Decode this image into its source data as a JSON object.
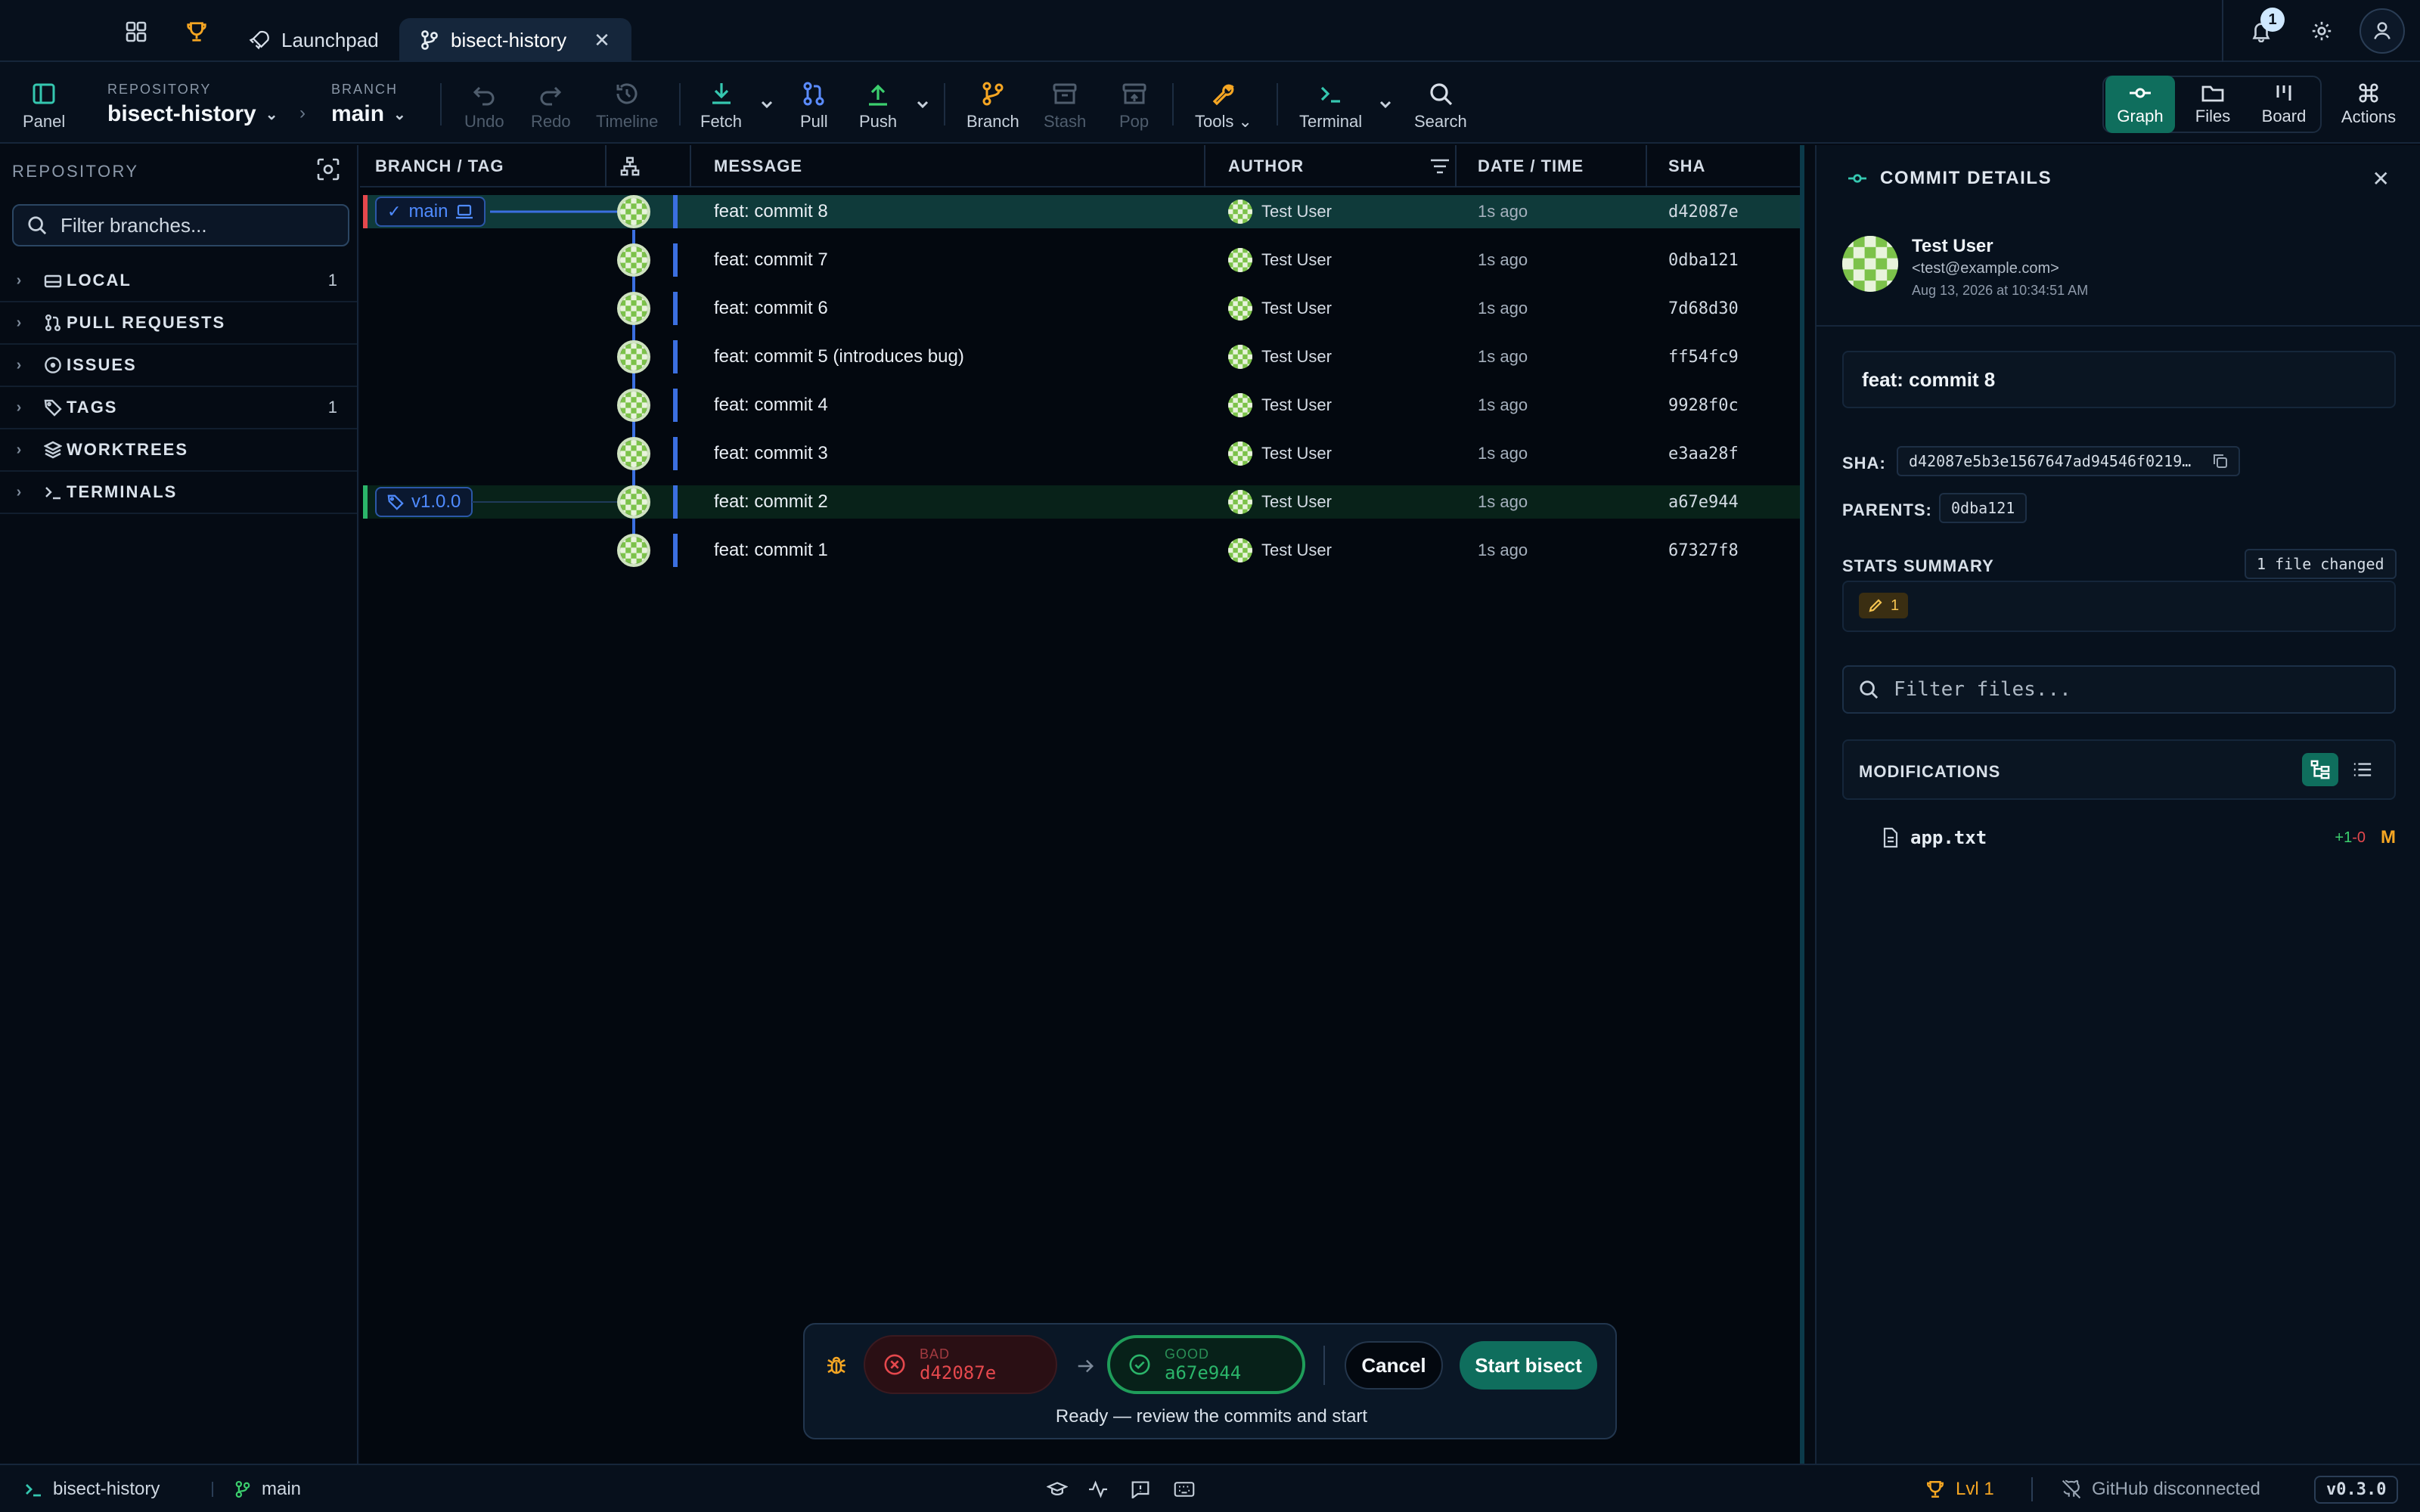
{
  "colors": {
    "accent": "#0f6e5d",
    "lane": "#3b6fe0",
    "bad": "#e5484d",
    "good": "#2bb56a",
    "warn": "#f5a623",
    "avatar": "#7cc24a"
  },
  "tabs": {
    "launchpad": "Launchpad",
    "active": "bisect-history",
    "notifications": "1"
  },
  "toolbar": {
    "panel": "Panel",
    "repo_label": "REPOSITORY",
    "repo_value": "bisect-history",
    "branch_label": "BRANCH",
    "branch_value": "main",
    "undo": "Undo",
    "redo": "Redo",
    "timeline": "Timeline",
    "fetch": "Fetch",
    "pull": "Pull",
    "push": "Push",
    "branch": "Branch",
    "stash": "Stash",
    "pop": "Pop",
    "tools": "Tools",
    "terminal": "Terminal",
    "search": "Search",
    "graph": "Graph",
    "files": "Files",
    "board": "Board",
    "actions": "Actions"
  },
  "sidebar": {
    "title": "REPOSITORY",
    "filter_placeholder": "Filter branches...",
    "items": [
      {
        "label": "LOCAL",
        "count": "1",
        "icon": "hard-drive-icon"
      },
      {
        "label": "PULL REQUESTS",
        "count": "",
        "icon": "pull-request-icon"
      },
      {
        "label": "ISSUES",
        "count": "",
        "icon": "issue-icon"
      },
      {
        "label": "TAGS",
        "count": "1",
        "icon": "tag-icon"
      },
      {
        "label": "WORKTREES",
        "count": "",
        "icon": "layers-icon"
      },
      {
        "label": "TERMINALS",
        "count": "",
        "icon": "terminal-icon"
      }
    ]
  },
  "graph": {
    "headers": {
      "branch_tag": "BRANCH / TAG",
      "message": "MESSAGE",
      "author": "AUTHOR",
      "date": "DATE / TIME",
      "sha": "SHA"
    },
    "commits": [
      {
        "message": "feat: commit 8",
        "author": "Test User",
        "date": "1s ago",
        "sha": "d42087e",
        "ref": "main"
      },
      {
        "message": "feat: commit 7",
        "author": "Test User",
        "date": "1s ago",
        "sha": "0dba121",
        "ref": ""
      },
      {
        "message": "feat: commit 6",
        "author": "Test User",
        "date": "1s ago",
        "sha": "7d68d30",
        "ref": ""
      },
      {
        "message": "feat: commit 5 (introduces bug)",
        "author": "Test User",
        "date": "1s ago",
        "sha": "ff54fc9",
        "ref": ""
      },
      {
        "message": "feat: commit 4",
        "author": "Test User",
        "date": "1s ago",
        "sha": "9928f0c",
        "ref": ""
      },
      {
        "message": "feat: commit 3",
        "author": "Test User",
        "date": "1s ago",
        "sha": "e3aa28f",
        "ref": ""
      },
      {
        "message": "feat: commit 2",
        "author": "Test User",
        "date": "1s ago",
        "sha": "a67e944",
        "ref": "v1.0.0"
      },
      {
        "message": "feat: commit 1",
        "author": "Test User",
        "date": "1s ago",
        "sha": "67327f8",
        "ref": ""
      }
    ]
  },
  "details": {
    "title": "COMMIT DETAILS",
    "author_name": "Test User",
    "author_email": "<test@example.com>",
    "author_date": "Aug 13, 2026 at 10:34:51 AM",
    "message": "feat: commit 8",
    "sha_label": "SHA:",
    "sha_value": "d42087e5b3e1567647ad94546f0219…",
    "parents_label": "PARENTS:",
    "parents_value": "0dba121",
    "stats_label": "STATS SUMMARY",
    "files_changed": "1 file changed",
    "modified_count": "1",
    "filter_placeholder": "Filter files...",
    "modifications_label": "MODIFICATIONS",
    "file": {
      "name": "app.txt",
      "added": "+1",
      "removed": "-0",
      "status": "M"
    }
  },
  "bisect": {
    "bad_label": "BAD",
    "bad_sha": "d42087e",
    "good_label": "GOOD",
    "good_sha": "a67e944",
    "cancel": "Cancel",
    "start": "Start bisect",
    "status": "Ready — review the commits and start"
  },
  "statusbar": {
    "repo": "bisect-history",
    "branch": "main",
    "level": "Lvl 1",
    "github": "GitHub disconnected",
    "version": "v0.3.0"
  }
}
